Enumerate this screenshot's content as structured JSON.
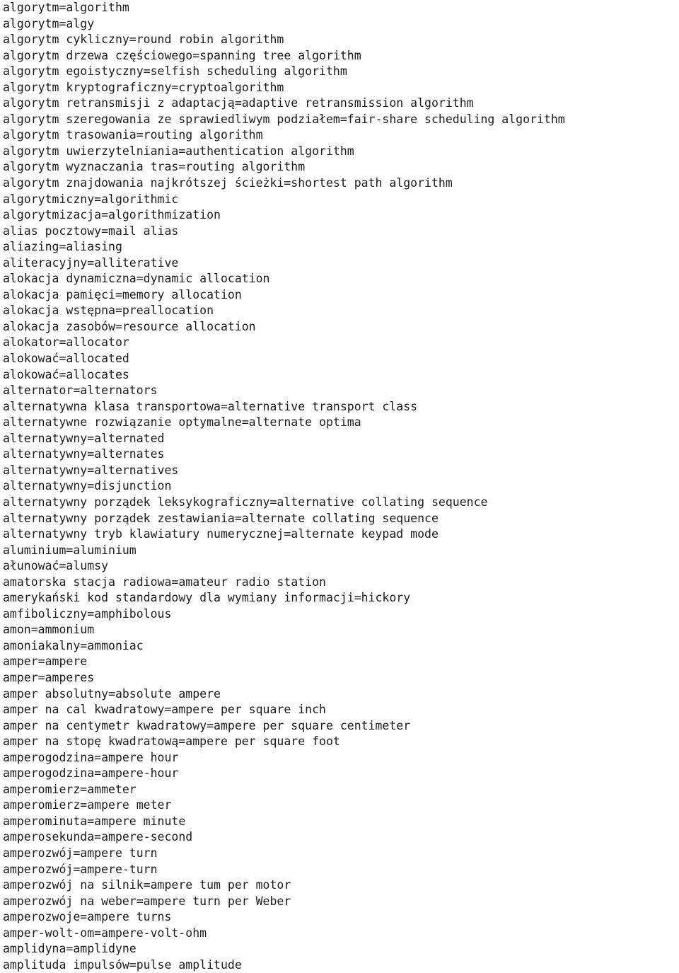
{
  "document": {
    "type": "plain-text-glossary",
    "language_pair": "Polish=English",
    "background_color": "#ffffff",
    "text_color": "#1b1b1b",
    "entries": [
      "algorytm=algorithm",
      "algorytm=algy",
      "algorytm cykliczny=round robin algorithm",
      "algorytm drzewa częściowego=spanning tree algorithm",
      "algorytm egoistyczny=selfish scheduling algorithm",
      "algorytm kryptograficzny=cryptoalgorithm",
      "algorytm retransmisji z adaptacją=adaptive retransmission algorithm",
      "algorytm szeregowania ze sprawiedliwym podziałem=fair-share scheduling algorithm",
      "algorytm trasowania=routing algorithm",
      "algorytm uwierzytelniania=authentication algorithm",
      "algorytm wyznaczania tras=routing algorithm",
      "algorytm znajdowania najkrótszej ścieżki=shortest path algorithm",
      "algorytmiczny=algorithmic",
      "algorytmizacja=algorithmization",
      "alias pocztowy=mail alias",
      "aliazing=aliasing",
      "aliteracyjny=alliterative",
      "alokacja dynamiczna=dynamic allocation",
      "alokacja pamięci=memory allocation",
      "alokacja wstępna=preallocation",
      "alokacja zasobów=resource allocation",
      "alokator=allocator",
      "alokować=allocated",
      "alokować=allocates",
      "alternator=alternators",
      "alternatywna klasa transportowa=alternative transport class",
      "alternatywne rozwiązanie optymalne=alternate optima",
      "alternatywny=alternated",
      "alternatywny=alternates",
      "alternatywny=alternatives",
      "alternatywny=disjunction",
      "alternatywny porządek leksykograficzny=alternative collating sequence",
      "alternatywny porządek zestawiania=alternate collating sequence",
      "alternatywny tryb klawiatury numerycznej=alternate keypad mode",
      "aluminium=aluminium",
      "ałunować=alumsy",
      "amatorska stacja radiowa=amateur radio station",
      "amerykański kod standardowy dla wymiany informacji=hickory",
      "amfiboliczny=amphibolous",
      "amon=ammonium",
      "amoniakalny=ammoniac",
      "amper=ampere",
      "amper=amperes",
      "amper absolutny=absolute ampere",
      "amper na cal kwadratowy=ampere per square inch",
      "amper na centymetr kwadratowy=ampere per square centimeter",
      "amper na stopę kwadratową=ampere per square foot",
      "amperogodzina=ampere hour",
      "amperogodzina=ampere-hour",
      "amperomierz=ammeter",
      "amperomierz=ampere meter",
      "amperominuta=ampere minute",
      "amperosekunda=ampere-second",
      "amperozwój=ampere turn",
      "amperozwój=ampere-turn",
      "amperozwój na silnik=ampere tum per motor",
      "amperozwój na weber=ampere turn per Weber",
      "amperozwoje=ampere turns",
      "amper-wolt-om=ampere-volt-ohm",
      "amplidyna=amplidyne",
      "amplituda impulsów=pulse amplitude"
    ]
  }
}
